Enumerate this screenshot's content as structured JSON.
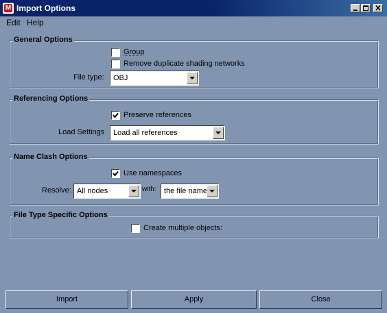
{
  "window": {
    "title": "Import Options",
    "icon": "maya-app-icon",
    "controls": [
      "minimize-icon",
      "maximize-icon",
      "close-icon"
    ]
  },
  "menubar": {
    "items": [
      "Edit",
      "Help"
    ]
  },
  "general_options": {
    "title": "General Options",
    "group_label": "Group",
    "group_checked": false,
    "remove_dup_label": "Remove duplicate shading networks",
    "remove_dup_checked": false,
    "file_type_label": "File type:",
    "file_type_value": "OBJ"
  },
  "referencing_options": {
    "title": "Referencing Options",
    "preserve_label": "Preserve references",
    "preserve_checked": true,
    "load_settings_label": "Load Settings",
    "load_settings_value": "Load all references"
  },
  "name_clash_options": {
    "title": "Name Clash Options",
    "use_namespaces_label": "Use namespaces",
    "use_namespaces_checked": true,
    "resolve_label": "Resolve:",
    "resolve_value": "All nodes",
    "with_label": "with:",
    "with_value": "the file name"
  },
  "file_type_specific": {
    "title": "File Type Specific Options",
    "multiple_objects_label": "Create multiple objects:",
    "multiple_objects_checked": false
  },
  "buttons": {
    "import": "Import",
    "apply": "Apply",
    "close": "Close"
  },
  "colors": {
    "background": "#8195b1",
    "titlebar": "#0a246a",
    "field": "#ffffff"
  }
}
